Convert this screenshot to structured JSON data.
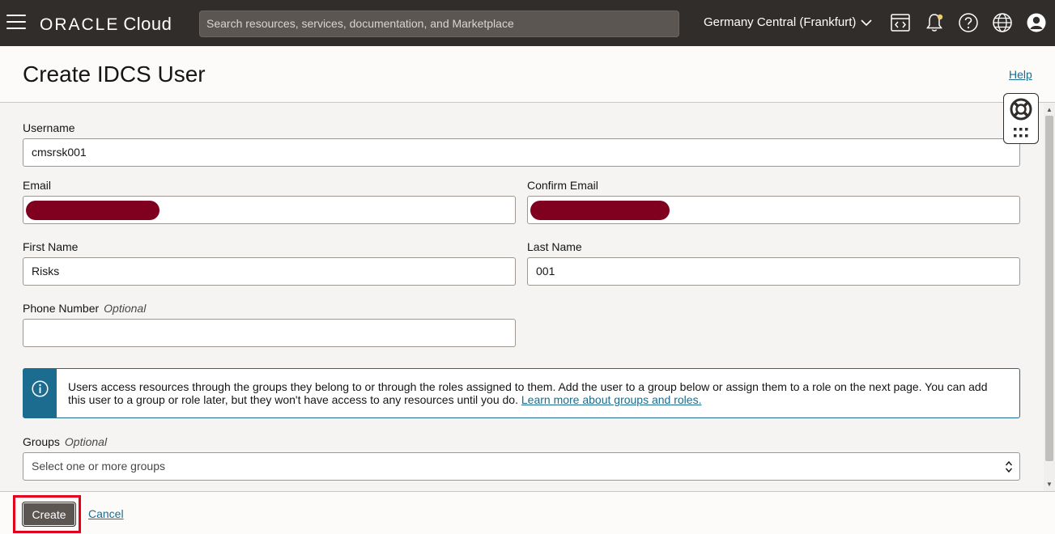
{
  "topbar": {
    "brand_oracle": "ORACLE",
    "brand_cloud": "Cloud",
    "search_placeholder": "Search resources, services, documentation, and Marketplace",
    "region": "Germany Central (Frankfurt)",
    "icons": [
      "menu-icon",
      "code-editor-icon",
      "bell-icon",
      "help-icon",
      "globe-icon",
      "user-icon"
    ]
  },
  "header": {
    "title": "Create IDCS User",
    "help_link": "Help"
  },
  "form": {
    "username": {
      "label": "Username",
      "value": "cmsrsk001"
    },
    "email": {
      "label": "Email",
      "value": ""
    },
    "confirm_email": {
      "label": "Confirm Email",
      "value": ""
    },
    "first_name": {
      "label": "First Name",
      "value": "Risks"
    },
    "last_name": {
      "label": "Last Name",
      "value": "001"
    },
    "phone": {
      "label": "Phone Number",
      "optional": "Optional",
      "value": ""
    },
    "info": {
      "text": "Users access resources through the groups they belong to or through the roles assigned to them. Add the user to a group below or assign them to a role on the next page. You can add this user to a group or role later, but they won't have access to any resources until you do.",
      "link": "Learn more about groups and roles."
    },
    "groups": {
      "label": "Groups",
      "optional": "Optional",
      "placeholder": "Select one or more groups"
    }
  },
  "footer": {
    "create_label": "Create",
    "cancel_label": "Cancel"
  },
  "colors": {
    "topbar_bg": "#312d2a",
    "link": "#1b6c8e",
    "info_accent": "#1b6c8e",
    "highlight": "#e3001b",
    "redaction": "#800020"
  }
}
